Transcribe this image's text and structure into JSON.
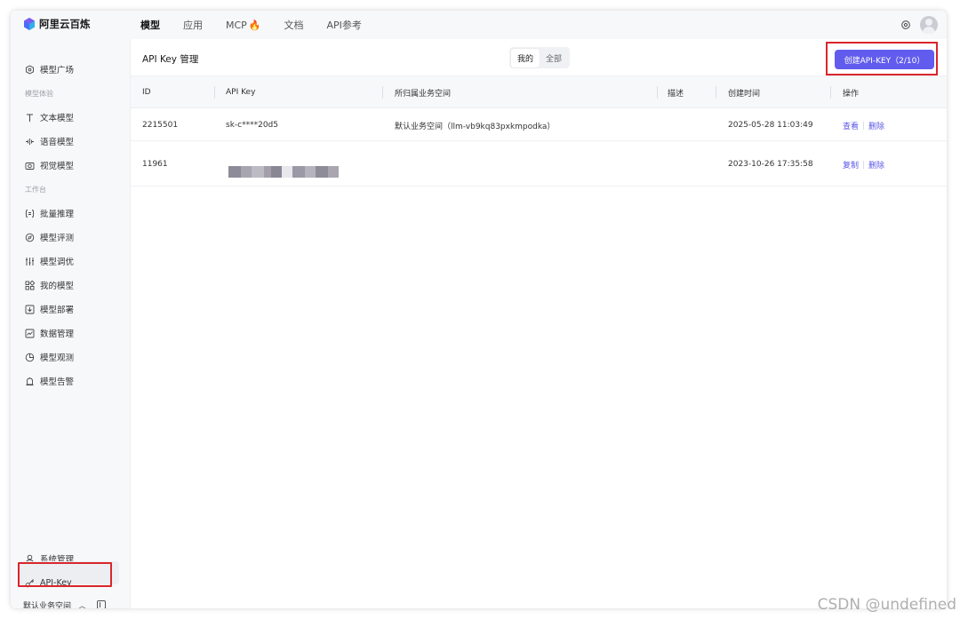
{
  "brand": {
    "name": "阿里云百炼"
  },
  "nav": {
    "items": [
      {
        "label": "模型",
        "active": true
      },
      {
        "label": "应用",
        "active": false
      },
      {
        "label": "MCP",
        "active": false,
        "badge": "🔥"
      },
      {
        "label": "文档",
        "active": false
      },
      {
        "label": "API参考",
        "active": false
      }
    ]
  },
  "sidebar": {
    "top_item": {
      "label": "模型广场",
      "icon": "compass-icon"
    },
    "group1": "模型体验",
    "group1_items": [
      {
        "label": "文本模型",
        "icon": "text-icon"
      },
      {
        "label": "语音模型",
        "icon": "audio-icon"
      },
      {
        "label": "视觉模型",
        "icon": "camera-icon"
      }
    ],
    "group2": "工作台",
    "group2_items": [
      {
        "label": "批量推理",
        "icon": "batch-icon"
      },
      {
        "label": "模型评测",
        "icon": "evaluate-icon"
      },
      {
        "label": "模型调优",
        "icon": "tune-icon"
      },
      {
        "label": "我的模型",
        "icon": "grid-icon"
      },
      {
        "label": "模型部署",
        "icon": "deploy-icon"
      },
      {
        "label": "数据管理",
        "icon": "chart-icon"
      },
      {
        "label": "模型观测",
        "icon": "pie-icon"
      },
      {
        "label": "模型告警",
        "icon": "alarm-icon"
      }
    ],
    "bottom_items": [
      {
        "label": "系统管理",
        "icon": "user-icon"
      },
      {
        "label": "API-Key",
        "icon": "key-icon",
        "active": true
      }
    ],
    "workspace": "默认业务空间"
  },
  "main": {
    "title": "API Key 管理",
    "segment": {
      "mine": "我的",
      "all": "全部",
      "selected": "我的"
    },
    "create_button": "创建API-KEY（2/10）",
    "columns": [
      "ID",
      "API Key",
      "所归属业务空间",
      "描述",
      "创建时间",
      "操作"
    ],
    "rows": [
      {
        "id": "2215501",
        "api_key": "sk-c****20d5",
        "workspace": "默认业务空间（llm-vb9kq83pxkmpodka）",
        "description": "",
        "created": "2025-05-28 11:03:49",
        "actions": [
          "查看",
          "删除"
        ]
      },
      {
        "id": "11961",
        "api_key": "",
        "workspace": "",
        "description": "",
        "created": "2023-10-26 17:35:58",
        "actions": [
          "复制",
          "删除"
        ]
      }
    ]
  },
  "colors": {
    "accent": "#615ced",
    "highlight_border": "#d9262b",
    "link": "#5b57e6"
  },
  "watermark": "CSDN @undefined"
}
